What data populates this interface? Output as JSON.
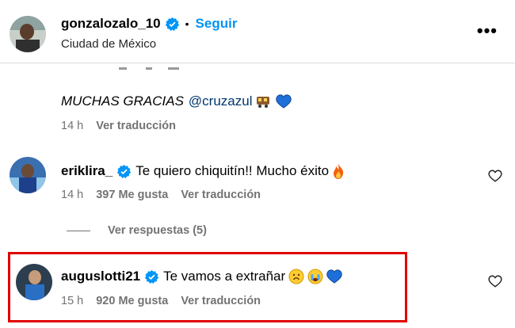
{
  "header": {
    "username": "gonzalozalo_10",
    "dot": "•",
    "follow_label": "Seguir",
    "location": "Ciudad de México",
    "more_label": "•••"
  },
  "caption": {
    "text": "MUCHAS GRACIAS",
    "mention": "@cruzazul",
    "time": "14 h",
    "translate_label": "Ver traducción"
  },
  "comments": [
    {
      "username": "eriklira_",
      "text": "Te quiero chiquitín!! Mucho éxito",
      "time": "14 h",
      "likes": "397 Me gusta",
      "translate_label": "Ver traducción"
    },
    {
      "username": "auguslotti21",
      "text": "Te vamos a extrañar",
      "time": "15 h",
      "likes": "920 Me gusta",
      "translate_label": "Ver traducción"
    }
  ],
  "replies_label": "Ver respuestas (5)",
  "colors": {
    "accent": "#0095f6",
    "highlight": "#e00000",
    "muted": "#737373"
  }
}
